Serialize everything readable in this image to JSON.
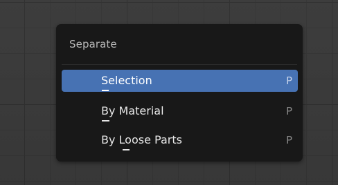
{
  "menu": {
    "title": "Separate",
    "items": [
      {
        "label": "Selection",
        "shortcut": "P",
        "active": true
      },
      {
        "label": "By Material",
        "shortcut": "P",
        "active": false
      },
      {
        "label": "By Loose Parts",
        "shortcut": "P",
        "active": false
      }
    ]
  },
  "colors": {
    "highlight": "#4772b3",
    "menu_background": "#181818",
    "viewport_background": "#393939"
  }
}
